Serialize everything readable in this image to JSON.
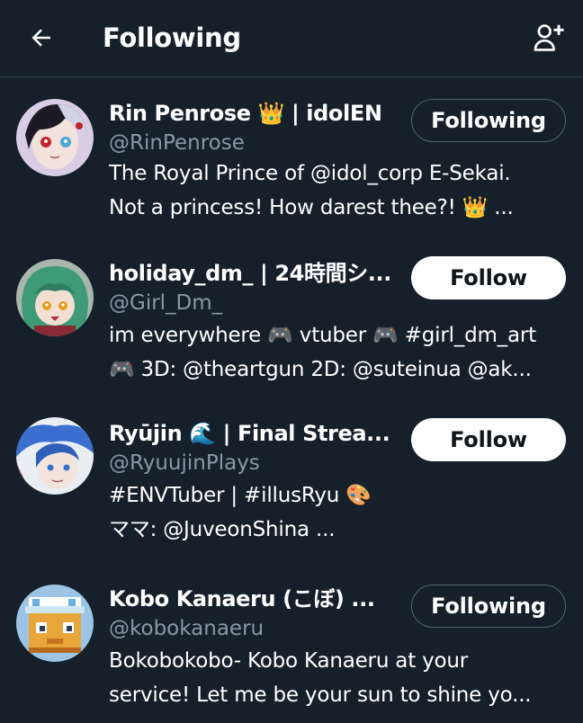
{
  "header": {
    "title": "Following",
    "back_icon": "arrow-left-icon",
    "add_icon": "add-user-icon"
  },
  "users": [
    {
      "name": "Rin Penrose 👑 | idolEN",
      "handle": "@RinPenrose",
      "bio": [
        "The Royal Prince of @idol_corp E-Sekai.",
        "Not a princess! How darest thee?! 👑 ..."
      ],
      "button": "Following"
    },
    {
      "name": "holiday_dm_ | 24時間シ...",
      "handle": "@Girl_Dm_",
      "bio": [
        "im everywhere 🎮 vtuber 🎮 #girl_dm_art",
        "🎮 3D: @theartgun 2D: @suteinua @ak..."
      ],
      "button": "Follow"
    },
    {
      "name": "Ryūjin 🌊 | Final Strea...",
      "handle": "@RyuujinPlays",
      "bio": [
        "#ENVTuber | #illusRyu 🎨",
        "ママ: @JuveonShina ..."
      ],
      "button": "Follow"
    },
    {
      "name": "Kobo Kanaeru (こぼ) ...",
      "handle": "@kobokanaeru",
      "bio": [
        "Bokobokobo- Kobo Kanaeru at your",
        "service! Let me be your sun to shine yo..."
      ],
      "button": "Following"
    }
  ],
  "colors": {
    "background": "#15202b",
    "divider": "#38444d",
    "secondary_text": "#8899a6",
    "button_outline": "#536471"
  }
}
